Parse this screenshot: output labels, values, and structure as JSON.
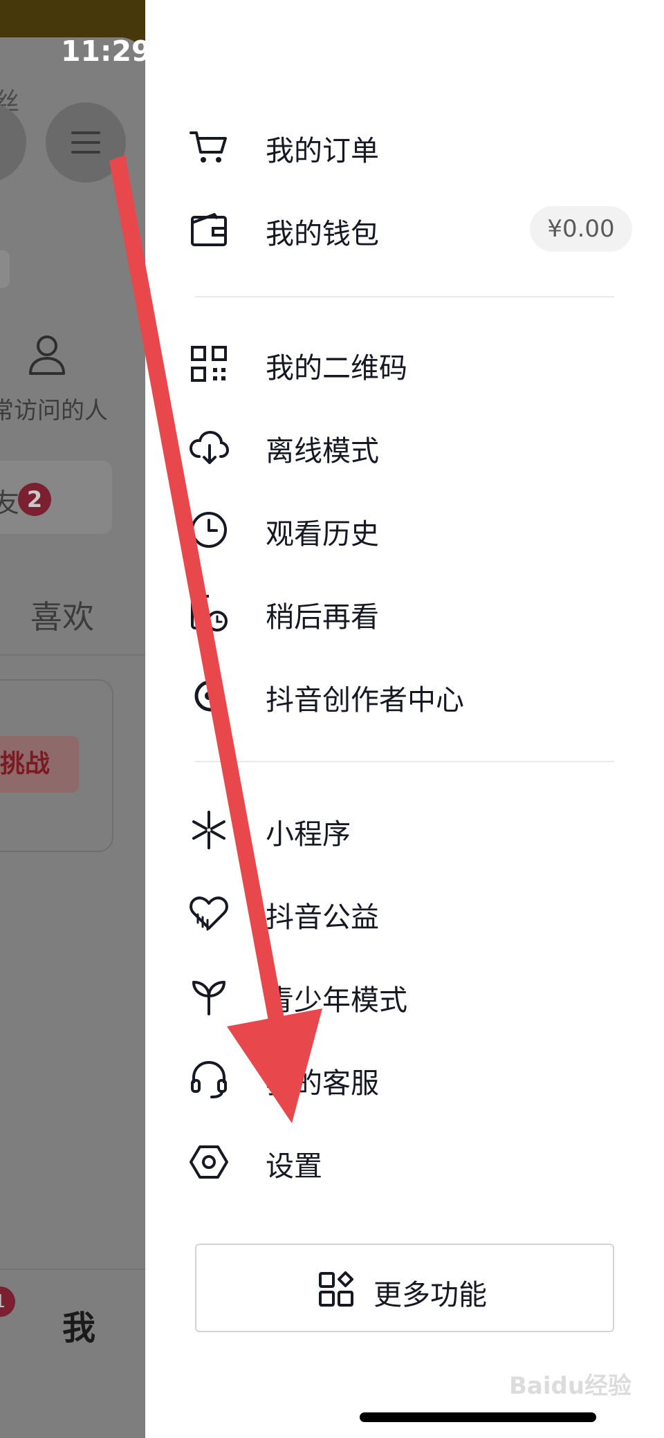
{
  "status_bar": {
    "time": "11:29"
  },
  "profile_background": {
    "fans_label": "丝",
    "visitors_label": "常访问的人",
    "card_label": "友",
    "card_badge": "2",
    "likes_tab": "喜欢",
    "challenge_label": "挑战",
    "nav_badge": "1",
    "me_tab": "我"
  },
  "drawer": {
    "sections": [
      [
        {
          "icon": "cart-icon",
          "label": "我的订单"
        },
        {
          "icon": "wallet-icon",
          "label": "我的钱包",
          "balance": "¥0.00"
        }
      ],
      [
        {
          "icon": "qr-code-icon",
          "label": "我的二维码"
        },
        {
          "icon": "cloud-download-icon",
          "label": "离线模式"
        },
        {
          "icon": "clock-icon",
          "label": "观看历史"
        },
        {
          "icon": "watch-later-icon",
          "label": "稍后再看"
        },
        {
          "icon": "creator-center-icon",
          "label": "抖音创作者中心"
        }
      ],
      [
        {
          "icon": "mini-program-icon",
          "label": "小程序"
        },
        {
          "icon": "charity-heart-icon",
          "label": "抖音公益"
        },
        {
          "icon": "sprout-icon",
          "label": "青少年模式"
        },
        {
          "icon": "headset-icon",
          "label": "我的客服"
        },
        {
          "icon": "settings-hexagon-icon",
          "label": "设置"
        }
      ]
    ],
    "more_button": {
      "icon": "grid-apps-icon",
      "label": "更多功能"
    }
  },
  "watermark": "Baidu经验",
  "colors": {
    "arrow": "#e8474c",
    "text": "#161823",
    "overlay": "#7e7e7e"
  }
}
